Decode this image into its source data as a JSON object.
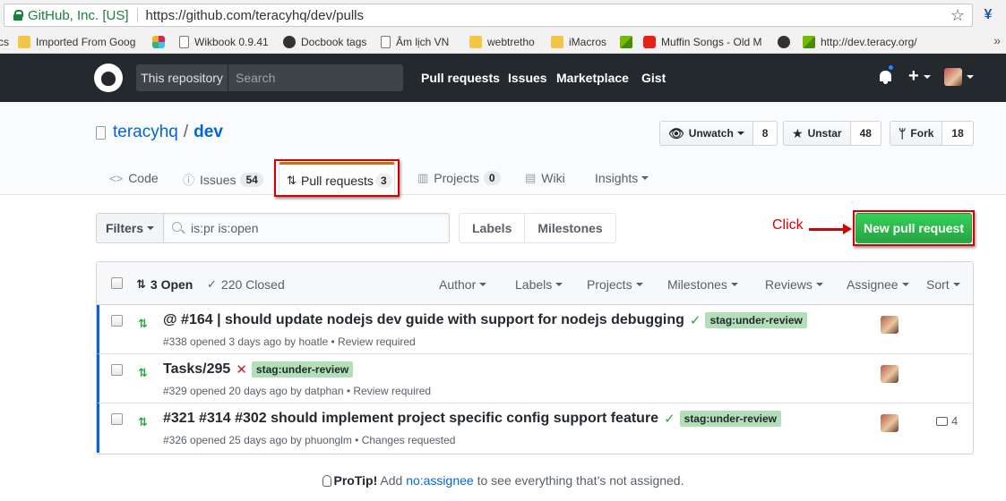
{
  "browser": {
    "site_label": "GitHub, Inc. [US]",
    "url": "https://github.com/teracyhq/dev/pulls",
    "bookmarks": [
      {
        "label": "cs",
        "icon": "none"
      },
      {
        "label": "Imported From Goog",
        "icon": "folder-icon"
      },
      {
        "label": "",
        "icon": "slack-icon"
      },
      {
        "label": "Wikbook 0.9.41",
        "icon": "page-icon"
      },
      {
        "label": "Docbook tags",
        "icon": "dark-icon"
      },
      {
        "label": "Âm lịch VN",
        "icon": "calendar-icon"
      },
      {
        "label": "webtretho",
        "icon": "folder-icon"
      },
      {
        "label": "iMacros",
        "icon": "folder-icon"
      },
      {
        "label": "",
        "icon": "green-icon"
      },
      {
        "label": "Muffin Songs - Old M",
        "icon": "youtube-icon"
      },
      {
        "label": "",
        "icon": "github-icon"
      },
      {
        "label": "http://dev.teracy.org/",
        "icon": "green-icon"
      }
    ]
  },
  "header": {
    "scope": "This repository",
    "search_placeholder": "Search",
    "nav": [
      "Pull requests",
      "Issues",
      "Marketplace",
      "Gist"
    ]
  },
  "repo": {
    "owner": "teracyhq",
    "separator": "/",
    "name": "dev",
    "watch": {
      "label": "Unwatch",
      "count": "8"
    },
    "star": {
      "label": "Unstar",
      "count": "48"
    },
    "fork": {
      "label": "Fork",
      "count": "18"
    },
    "tabs": {
      "code": "Code",
      "issues": {
        "label": "Issues",
        "count": "54"
      },
      "pulls": {
        "label": "Pull requests",
        "count": "3"
      },
      "projects": {
        "label": "Projects",
        "count": "0"
      },
      "wiki": "Wiki",
      "insights": "Insights"
    }
  },
  "subnav": {
    "filters": "Filters",
    "query": "is:pr is:open",
    "labels": "Labels",
    "milestones": "Milestones",
    "new_pr": "New pull request",
    "annotation": "Click"
  },
  "list": {
    "open": "3 Open",
    "closed": "220 Closed",
    "filters": [
      "Author",
      "Labels",
      "Projects",
      "Milestones",
      "Reviews",
      "Assignee",
      "Sort"
    ],
    "rows": [
      {
        "title": "@ #164 | should update nodejs dev guide with support for nodejs debugging",
        "status": "success",
        "label": "stag:under-review",
        "meta": "#338 opened 3 days ago by hoatle • Review required",
        "comments": ""
      },
      {
        "title": "Tasks/295",
        "status": "failure",
        "label": "stag:under-review",
        "meta": "#329 opened 20 days ago by datphan • Review required",
        "comments": ""
      },
      {
        "title": "#321 #314 #302 should implement project specific config support feature",
        "status": "success",
        "label": "stag:under-review",
        "meta": "#326 opened 25 days ago by phuonglm • Changes requested",
        "comments": "4"
      }
    ]
  },
  "protip": {
    "lead": "ProTip!",
    "pre": "Add",
    "link": "no:assignee",
    "post": "to see everything that’s not assigned."
  },
  "colors": {
    "accent": "#0366d6",
    "success": "#28a745",
    "annotation": "#d50000",
    "header_bg": "#24292e"
  }
}
